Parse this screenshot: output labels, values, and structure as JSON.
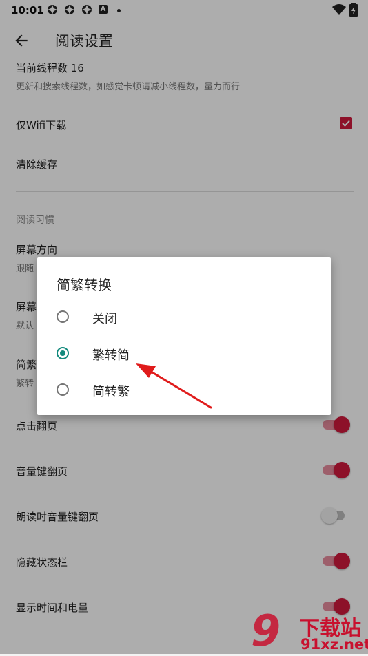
{
  "status_bar": {
    "time": "10:01",
    "notification_label": "A"
  },
  "app_bar": {
    "title": "阅读设置"
  },
  "settings": {
    "thread_count": {
      "title": "当前线程数 16",
      "summary": "更新和搜索线程数，如感觉卡顿请减小线程数，量力而行"
    },
    "wifi_only": {
      "title": "仅Wifi下载",
      "checked": true
    },
    "clear_cache": {
      "title": "清除缓存"
    },
    "reading_habits": "阅读习惯",
    "screen_orientation": {
      "title": "屏幕方向",
      "summary": "跟随"
    },
    "screen_timeout": {
      "title": "屏幕",
      "summary": "默认"
    },
    "chinese_convert": {
      "title": "简繁",
      "summary": "繁转"
    },
    "tap_to_flip": {
      "title": "点击翻页",
      "on": true
    },
    "volume_flip": {
      "title": "音量键翻页",
      "on": true
    },
    "tts_volume_flip": {
      "title": "朗读时音量键翻页",
      "on": false
    },
    "hide_status_bar": {
      "title": "隐藏状态栏",
      "on": true
    },
    "show_time_battery": {
      "title": "显示时间和电量",
      "on": true
    }
  },
  "dialog": {
    "title": "简繁转换",
    "options": [
      {
        "label": "关闭",
        "selected": false
      },
      {
        "label": "繁转简",
        "selected": true
      },
      {
        "label": "简转繁",
        "selected": false
      }
    ]
  },
  "watermark": {
    "logo": "9",
    "text_top": "下载站",
    "text_bottom": "91xz.net"
  },
  "colors": {
    "accent": "#d01a3d",
    "radio_accent": "#138a7d",
    "arrow": "#e01b1b"
  }
}
